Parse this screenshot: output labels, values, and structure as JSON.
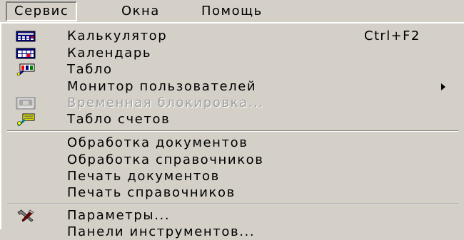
{
  "menubar": {
    "items": [
      {
        "label": "Сервис"
      },
      {
        "label": "Окна"
      },
      {
        "label": "Помощь"
      }
    ]
  },
  "menu": {
    "items": [
      {
        "label": "Калькулятор",
        "shortcut": "Ctrl+F2",
        "icon": "calculator-icon"
      },
      {
        "label": "Календарь",
        "icon": "calendar-icon"
      },
      {
        "label": "Табло",
        "icon": "scoreboard-icon"
      },
      {
        "label": "Монитор пользователей",
        "submenu": true
      },
      {
        "label": "Временная блокировка...",
        "disabled": true,
        "icon": "lock-screen-icon"
      },
      {
        "label": "Табло счетов",
        "icon": "accounts-board-icon"
      },
      {
        "label": "Обработка документов"
      },
      {
        "label": "Обработка справочников"
      },
      {
        "label": "Печать документов"
      },
      {
        "label": "Печать справочников"
      },
      {
        "label": "Параметры...",
        "icon": "tools-icon"
      },
      {
        "label": "Панели инструментов..."
      }
    ]
  },
  "colors": {
    "face": "#d4d0c8",
    "highlight": "#ffffff",
    "shadow": "#808080",
    "disabled_text": "#a0a0a0"
  }
}
